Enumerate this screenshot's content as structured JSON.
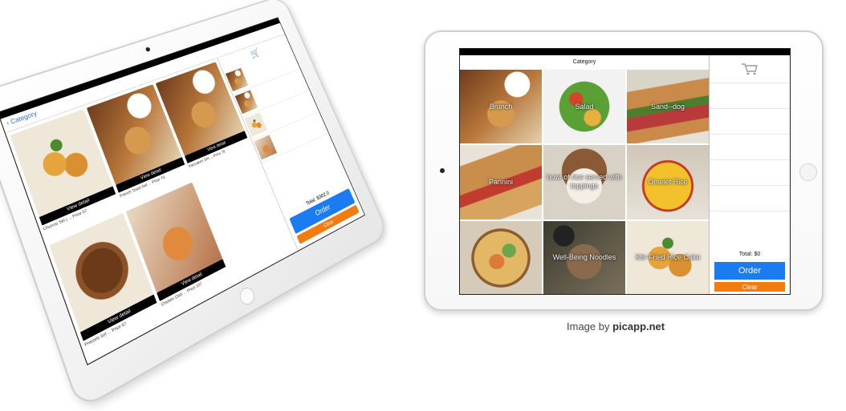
{
  "left_ipad": {
    "back_label": "Category",
    "menu_items": [
      {
        "view_button": "View detail",
        "caption": "Churros Set | ... Price 57"
      },
      {
        "view_button": "View detail",
        "caption": "French Toast Set ... Price 79"
      },
      {
        "view_button": "View detail",
        "caption": "Pancakes Set ... Price 78"
      },
      {
        "view_button": "View detail",
        "caption": "Pretzels Set ... Price 87"
      },
      {
        "view_button": "View detail",
        "caption": "Chicken Dish ... Price 107"
      }
    ],
    "total_label": "Total: $302.0",
    "order_label": "Order",
    "clear_label": "Clear"
  },
  "app": {
    "category_title": "Category",
    "tiles": [
      {
        "label": "Brunch",
        "texture": "f-brunch"
      },
      {
        "label": "Salad",
        "texture": "f-salad"
      },
      {
        "label": "Sand--dog",
        "texture": "f-sand"
      },
      {
        "label": "Pannini",
        "texture": "f-panini"
      },
      {
        "label": "bowl of rice served with toppings",
        "texture": "f-rice"
      },
      {
        "label": "Omelet Rice",
        "texture": "f-omelet"
      },
      {
        "label": "",
        "texture": "f-pizza"
      },
      {
        "label": "Well-Being Noodles",
        "texture": "f-noodle"
      },
      {
        "label": "Stir-Fried Rice Cake",
        "texture": "f-cake"
      }
    ],
    "cart": {
      "icon": "shopping-cart-icon",
      "total_label": "Total: $0",
      "order_label": "Order",
      "clear_label": "Clear"
    }
  },
  "credit": {
    "prefix": "Image by",
    "site": "picapp.net"
  },
  "colors": {
    "order_blue": "#1a7cf0",
    "clear_orange": "#f47b10"
  }
}
